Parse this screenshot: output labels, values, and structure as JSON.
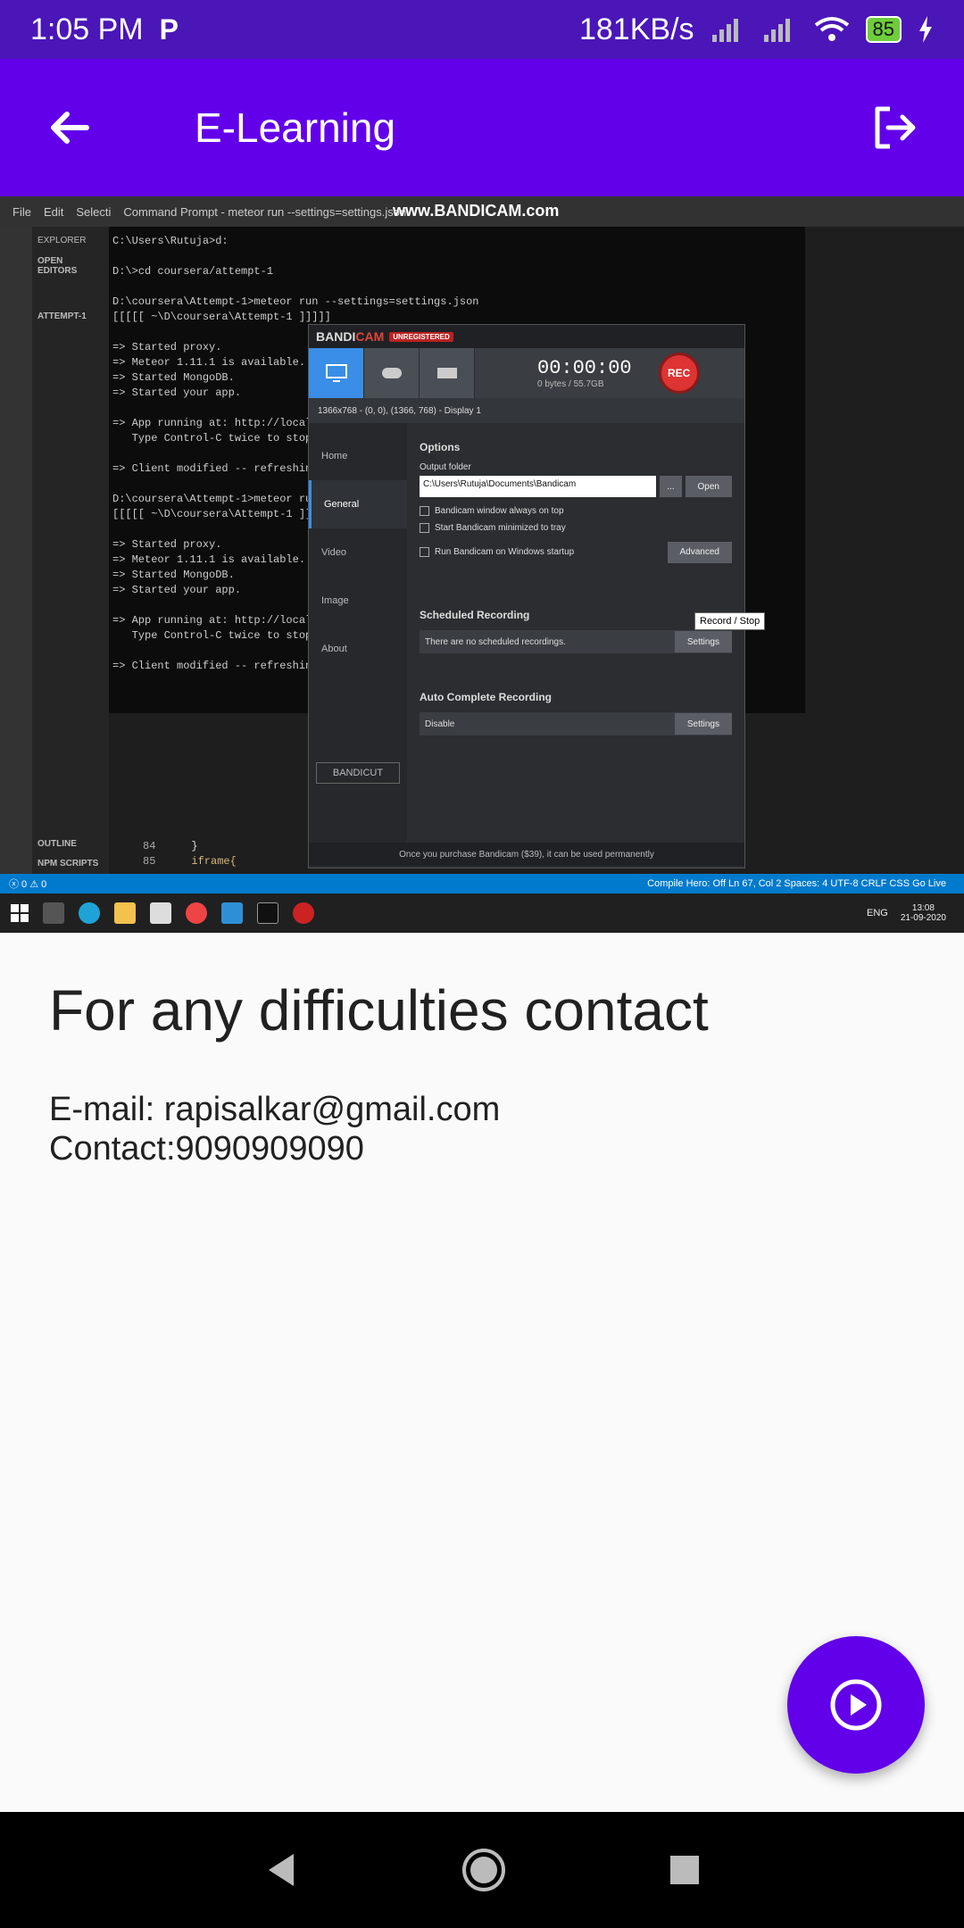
{
  "status_bar": {
    "time": "1:05 PM",
    "carrier_icon": "P",
    "network_speed": "181KB/s",
    "battery": "85"
  },
  "app_bar": {
    "title": "E-Learning"
  },
  "screenshot": {
    "vscode_menu": [
      "File",
      "Edit",
      "Selecti"
    ],
    "window_title": "Command Prompt - meteor run --settings=settings.json",
    "watermark": "www.BANDICAM.com",
    "sidebar": {
      "explorer": "EXPLORER",
      "open_editors": "OPEN EDITORS",
      "attempt": "ATTEMPT-1",
      "outline": "OUTLINE",
      "npm_scripts": "NPM SCRIPTS"
    },
    "cmd_lines": "C:\\Users\\Rutuja>d:\n\nD:\\>cd coursera/attempt-1\n\nD:\\coursera\\Attempt-1>meteor run --settings=settings.json\n[[[[[ ~\\D\\coursera\\Attempt-1 ]]]]]\n\n=> Started proxy.\n=> Meteor 1.11.1 is available. Upda\n=> Started MongoDB.\n=> Started your app.\n\n=> App running at: http://localhost\n   Type Control-C twice to stop.\n\n=> Client modified -- refreshing (x\n\nD:\\coursera\\Attempt-1>meteor run --\n[[[[[ ~\\D\\coursera\\Attempt-1 ]]]]]\n\n=> Started proxy.\n=> Meteor 1.11.1 is available. Upda\n=> Started MongoDB.\n=> Started your app.\n\n=> App running at: http://localhost\n   Type Control-C twice to stop.\n\n=> Client modified -- refreshing (x",
    "bandicam": {
      "brand_a": "BANDI",
      "brand_b": "CAM",
      "tag": "UNREGISTERED",
      "timer": "00:00:00",
      "size": "0 bytes / 55.7GB",
      "rec": "REC",
      "tooltip": "Record / Stop",
      "region": "1366x768 - (0, 0), (1366, 768) - Display 1",
      "nav": [
        "Home",
        "General",
        "Video",
        "Image",
        "About"
      ],
      "options": "Options",
      "output_folder": "Output folder",
      "folder_path": "C:\\Users\\Rutuja\\Documents\\Bandicam",
      "ellipsis": "...",
      "open": "Open",
      "check1": "Bandicam window always on top",
      "check2": "Start Bandicam minimized to tray",
      "check3": "Run Bandicam on Windows startup",
      "advanced": "Advanced",
      "scheduled": "Scheduled Recording",
      "no_scheduled": "There are no scheduled recordings.",
      "settings": "Settings",
      "auto_complete": "Auto Complete Recording",
      "disable": "Disable",
      "bandicut": "BANDICUT",
      "footer": "Once you purchase Bandicam ($39), it can be used permanently"
    },
    "vs_status": {
      "left": "ⓧ 0 ⚠ 0",
      "right": "Compile Hero: Off   Ln 67, Col 2   Spaces: 4   UTF-8   CRLF   CSS   Go Live"
    },
    "code_lines": [
      {
        "num": "84",
        "text": "}"
      },
      {
        "num": "85",
        "text": "iframe{"
      }
    ],
    "taskbar": {
      "lang": "ENG",
      "time": "13:08",
      "date": "21-09-2020"
    }
  },
  "content": {
    "heading": "For any difficulties contact",
    "email": "E-mail: rapisalkar@gmail.com",
    "contact": "Contact:9090909090"
  },
  "colors": {
    "primary": "#6200ea",
    "status_bar": "#4a16b8"
  }
}
